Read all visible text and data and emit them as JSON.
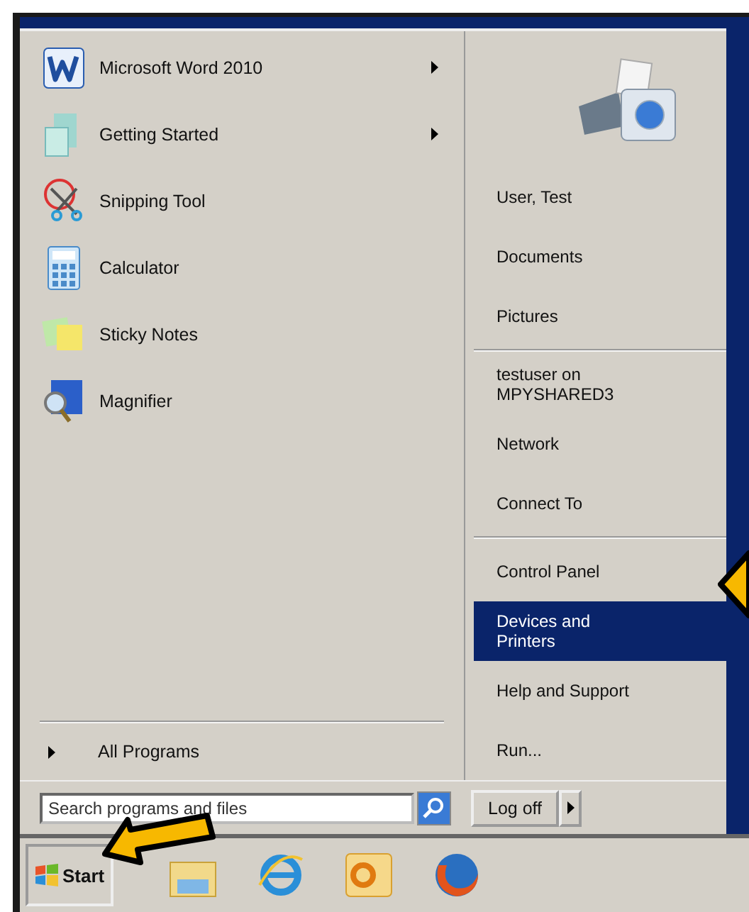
{
  "start_menu": {
    "pinned": [
      {
        "label": "Microsoft Word 2010",
        "has_submenu": true
      },
      {
        "label": "Getting Started",
        "has_submenu": true
      },
      {
        "label": "Snipping Tool",
        "has_submenu": false
      },
      {
        "label": "Calculator",
        "has_submenu": false
      },
      {
        "label": "Sticky Notes",
        "has_submenu": false
      },
      {
        "label": "Magnifier",
        "has_submenu": false
      }
    ],
    "all_programs": "All Programs",
    "right_groups": [
      [
        {
          "label": "User, Test",
          "selected": false
        },
        {
          "label": "Documents",
          "selected": false
        },
        {
          "label": "Pictures",
          "selected": false
        }
      ],
      [
        {
          "label": "testuser on MPYSHARED3",
          "selected": false
        },
        {
          "label": "Network",
          "selected": false
        },
        {
          "label": "Connect To",
          "selected": false
        }
      ],
      [
        {
          "label": "Control Panel",
          "selected": false
        },
        {
          "label": "Devices and Printers",
          "selected": true
        },
        {
          "label": "Help and Support",
          "selected": false
        },
        {
          "label": "Run...",
          "selected": false
        }
      ]
    ],
    "search": {
      "placeholder": "Search programs and files"
    },
    "log_off": "Log off"
  },
  "taskbar": {
    "start": "Start"
  }
}
